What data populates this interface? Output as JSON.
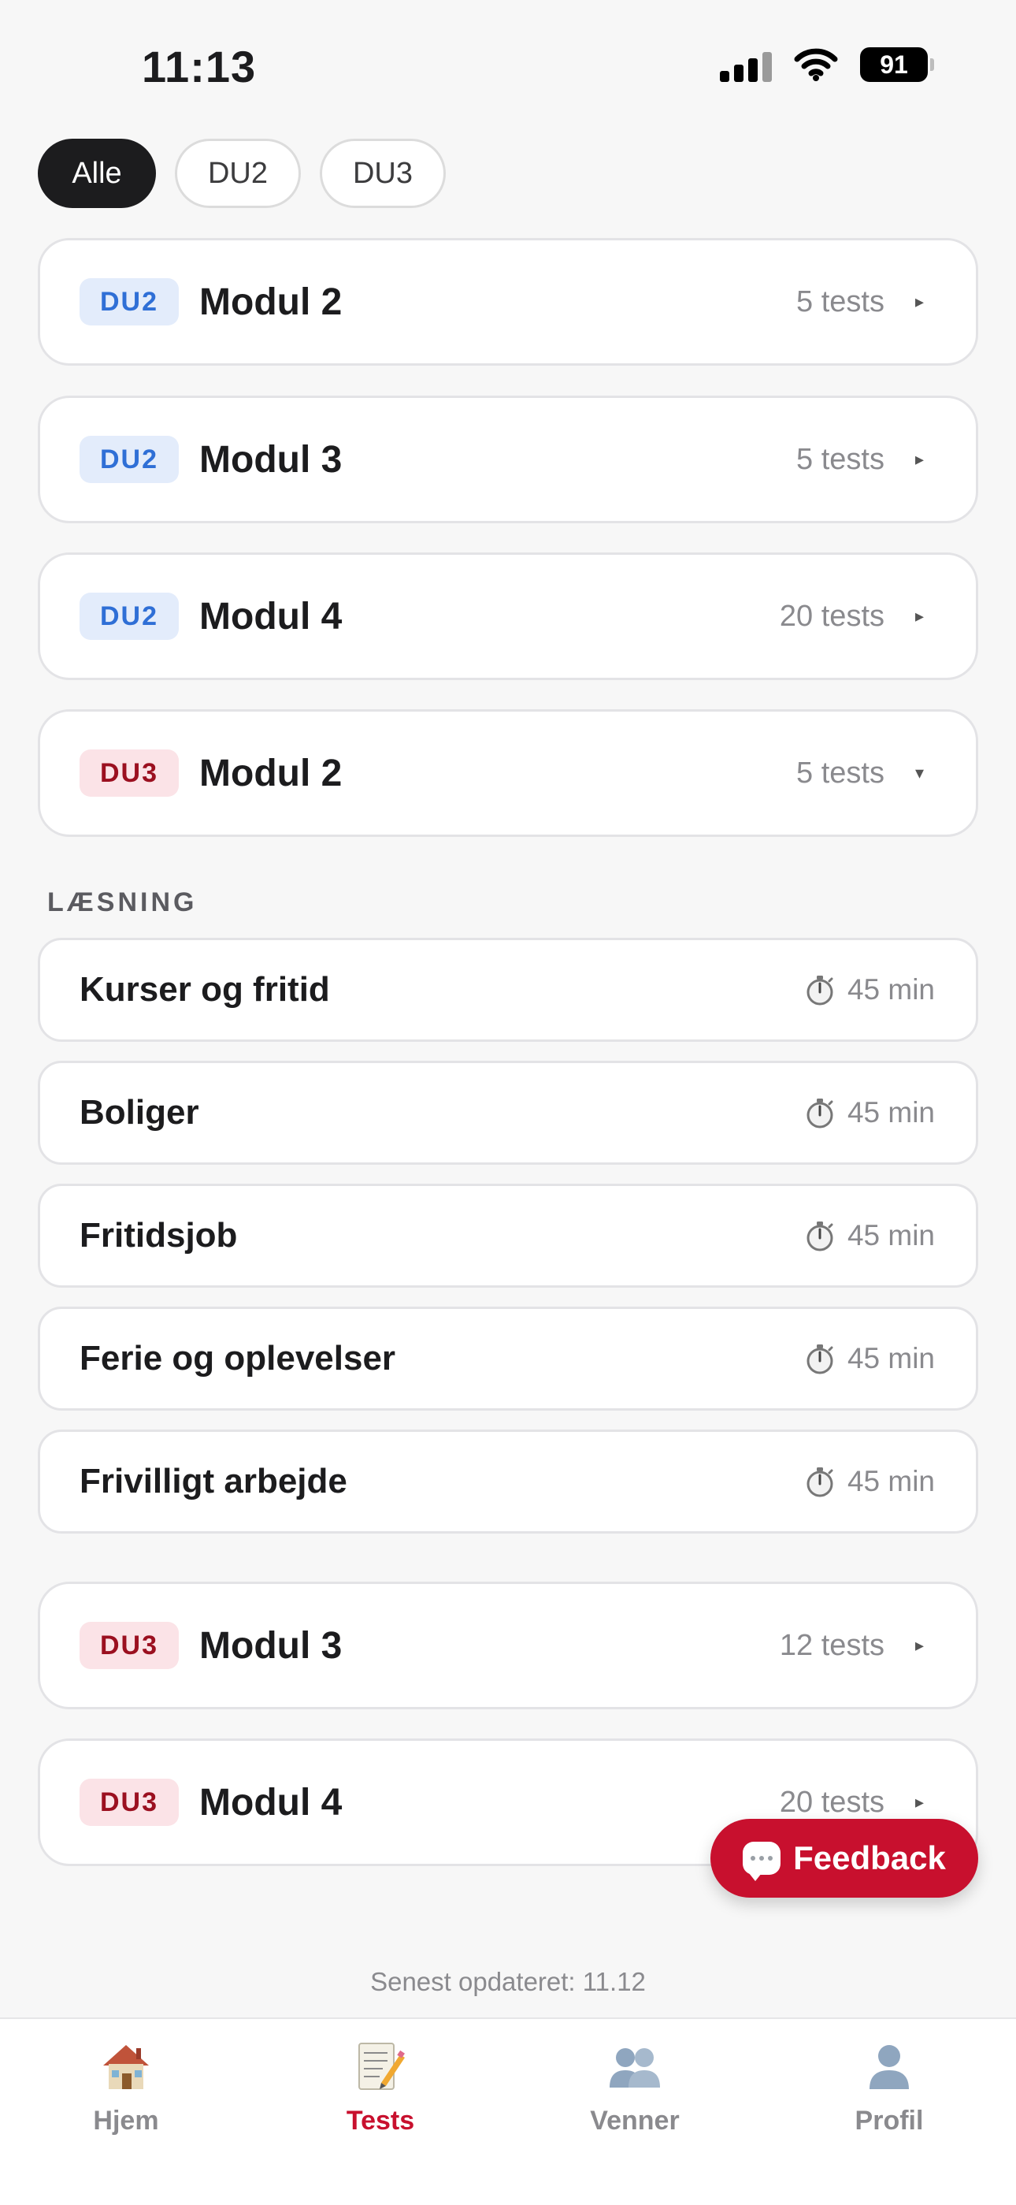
{
  "status_bar": {
    "time": "11:13",
    "battery": "91"
  },
  "filters": [
    {
      "label": "Alle",
      "active": true
    },
    {
      "label": "DU2",
      "active": false
    },
    {
      "label": "DU3",
      "active": false
    }
  ],
  "modules_top": [
    {
      "tag": "DU2",
      "title": "Modul 2",
      "count": "5 tests",
      "chevron": "▸"
    },
    {
      "tag": "DU2",
      "title": "Modul 3",
      "count": "5 tests",
      "chevron": "▸"
    },
    {
      "tag": "DU2",
      "title": "Modul 4",
      "count": "20 tests",
      "chevron": "▸"
    },
    {
      "tag": "DU3",
      "title": "Modul 2",
      "count": "5 tests",
      "chevron": "▾"
    }
  ],
  "reading_section": {
    "label": "LÆSNING",
    "items": [
      {
        "title": "Kurser og fritid",
        "duration": "45 min"
      },
      {
        "title": "Boliger",
        "duration": "45 min"
      },
      {
        "title": "Fritidsjob",
        "duration": "45 min"
      },
      {
        "title": "Ferie og oplevelser",
        "duration": "45 min"
      },
      {
        "title": "Frivilligt arbejde",
        "duration": "45 min"
      }
    ]
  },
  "modules_bottom": [
    {
      "tag": "DU3",
      "title": "Modul 3",
      "count": "12 tests",
      "chevron": "▸"
    },
    {
      "tag": "DU3",
      "title": "Modul 4",
      "count": "20 tests",
      "chevron": "▸"
    }
  ],
  "feedback_button": {
    "label": "Feedback",
    "color": "#c8102e"
  },
  "updated_text": "Senest opdateret: 11.12",
  "tabbar": [
    {
      "label": "Hjem",
      "icon": "house-icon",
      "active": false
    },
    {
      "label": "Tests",
      "icon": "memo-icon",
      "active": true
    },
    {
      "label": "Venner",
      "icon": "friends-icon",
      "active": false
    },
    {
      "label": "Profil",
      "icon": "profile-icon",
      "active": false
    }
  ],
  "colors": {
    "du2_accent": "#2f6fd6",
    "du3_accent": "#9b1020",
    "brand": "#c8102e"
  }
}
